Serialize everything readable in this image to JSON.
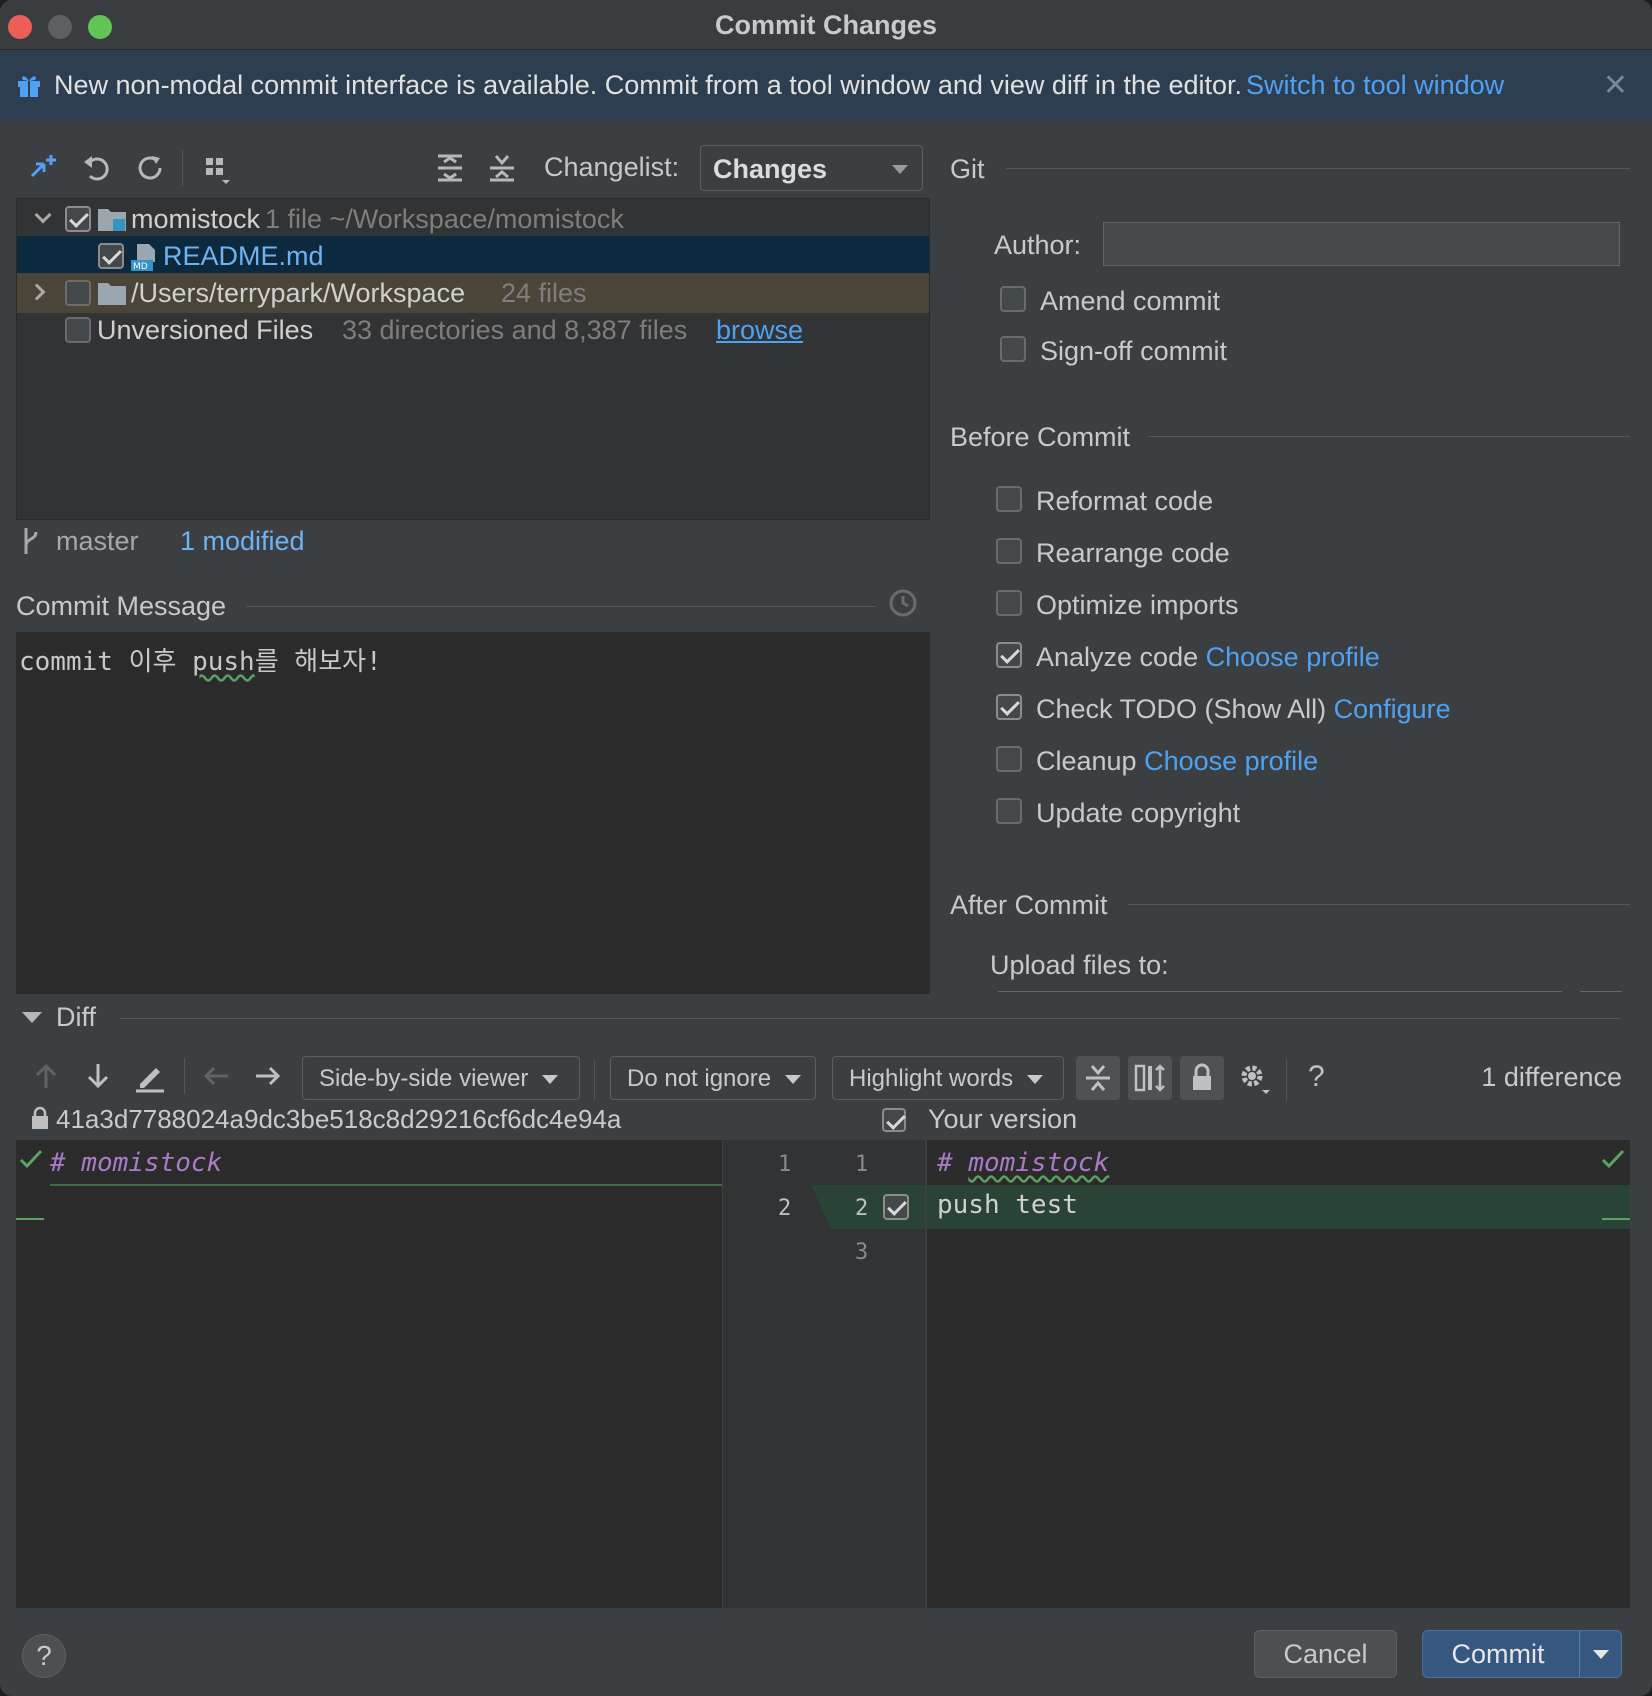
{
  "window": {
    "title": "Commit Changes"
  },
  "banner": {
    "message": "New non-modal commit interface is available. Commit from a tool window and view diff in the editor.",
    "link": "Switch to tool window"
  },
  "toolbar": {
    "changelist_label": "Changelist:",
    "changelist_value": "Changes"
  },
  "tree": {
    "root": {
      "name": "momistock",
      "meta": "1 file  ~/Workspace/momistock",
      "checked": true
    },
    "file": {
      "name": "README.md",
      "checked": true
    },
    "folder": {
      "name": "/Users/terrypark/Workspace",
      "meta": "24 files",
      "checked": false
    },
    "unversioned": {
      "name": "Unversioned Files",
      "meta": "33 directories and 8,387 files",
      "link": "browse",
      "checked": false
    }
  },
  "branch": {
    "name": "master",
    "status": "1 modified"
  },
  "commit_message": {
    "title": "Commit Message",
    "text_pre": "commit 이후 ",
    "text_word": "push",
    "text_post": "를 해보자!"
  },
  "git": {
    "title": "Git",
    "author_label": "Author:",
    "author_value": "",
    "amend": "Amend commit",
    "signoff": "Sign-off commit"
  },
  "before_commit": {
    "title": "Before Commit",
    "reformat": "Reformat code",
    "rearrange": "Rearrange code",
    "optimize": "Optimize imports",
    "analyze": "Analyze code",
    "analyze_link": "Choose profile",
    "todo": "Check TODO (Show All)",
    "todo_link": "Configure",
    "cleanup": "Cleanup",
    "cleanup_link": "Choose profile",
    "copyright": "Update copyright"
  },
  "after_commit": {
    "title": "After Commit",
    "upload_label": "Upload files to:"
  },
  "diff": {
    "title": "Diff",
    "viewer": "Side-by-side viewer",
    "ignore": "Do not ignore",
    "highlight": "Highlight words",
    "count": "1 difference",
    "left_header": "41a3d7788024a9dc3be518c8d29216cf6dc4e94a",
    "right_header": "Your version",
    "left_lines": [
      "# momistock"
    ],
    "right_line1_hash": "# ",
    "right_line1_word": "momistock",
    "right_line2": "push test",
    "left_nums": [
      "1",
      "2"
    ],
    "right_nums": [
      "1",
      "2",
      "3"
    ]
  },
  "buttons": {
    "cancel": "Cancel",
    "commit": "Commit",
    "help": "?"
  },
  "colors": {
    "accent": "#4ea1f3",
    "commit_button": "#365880",
    "added_line": "#294436",
    "selected_row": "#0d293e"
  }
}
